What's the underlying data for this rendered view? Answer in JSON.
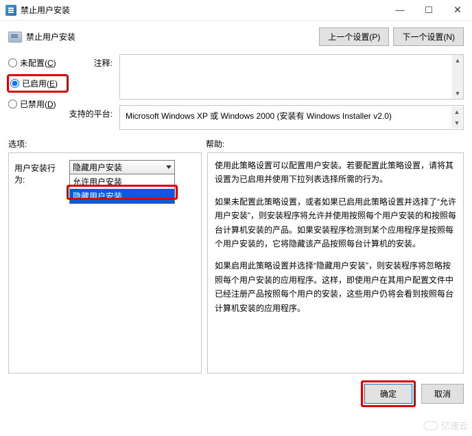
{
  "window": {
    "title": "禁止用户安装",
    "minimize": "—",
    "maximize": "☐",
    "close": "✕"
  },
  "subheader": {
    "title": "禁止用户安装",
    "prev": "上一个设置(P)",
    "next": "下一个设置(N)"
  },
  "radios": {
    "unconfigured": "未配置(C)",
    "unconfigured_letter": "C",
    "enabled": "已启用(E)",
    "enabled_letter": "E",
    "disabled": "已禁用(D)",
    "disabled_letter": "D"
  },
  "fields": {
    "comment_label": "注释:",
    "comment_value": "",
    "platform_label": "支持的平台:",
    "platform_value": "Microsoft Windows XP 或 Windows 2000 (安装有 Windows Installer v2.0)"
  },
  "sections": {
    "options": "选项:",
    "help": "帮助:"
  },
  "option": {
    "label": "用户安装行为:",
    "selected": "隐藏用户安装",
    "items": [
      "允许用户安装",
      "隐藏用户安装"
    ]
  },
  "help": {
    "p1": "使用此策略设置可以配置用户安装。若要配置此策略设置，请将其设置为已启用并使用下拉列表选择所需的行为。",
    "p2": "如果未配置此策略设置，或者如果已启用此策略设置并选择了“允许用户安装”，则安装程序将允许并使用按照每个用户安装的和按照每台计算机安装的产品。如果安装程序检测到某个应用程序是按照每个用户安装的，它将隐藏该产品按照每台计算机的安装。",
    "p3": "如果启用此策略设置并选择“隐藏用户安装”，则安装程序将忽略按照每个用户安装的应用程序。这样，即使用户在其用户配置文件中已经注册产品按照每个用户的安装，这些用户仍将会看到按照每台计算机安装的应用程序。"
  },
  "footer": {
    "ok": "确定",
    "cancel": "取消"
  },
  "watermark": "亿速云"
}
